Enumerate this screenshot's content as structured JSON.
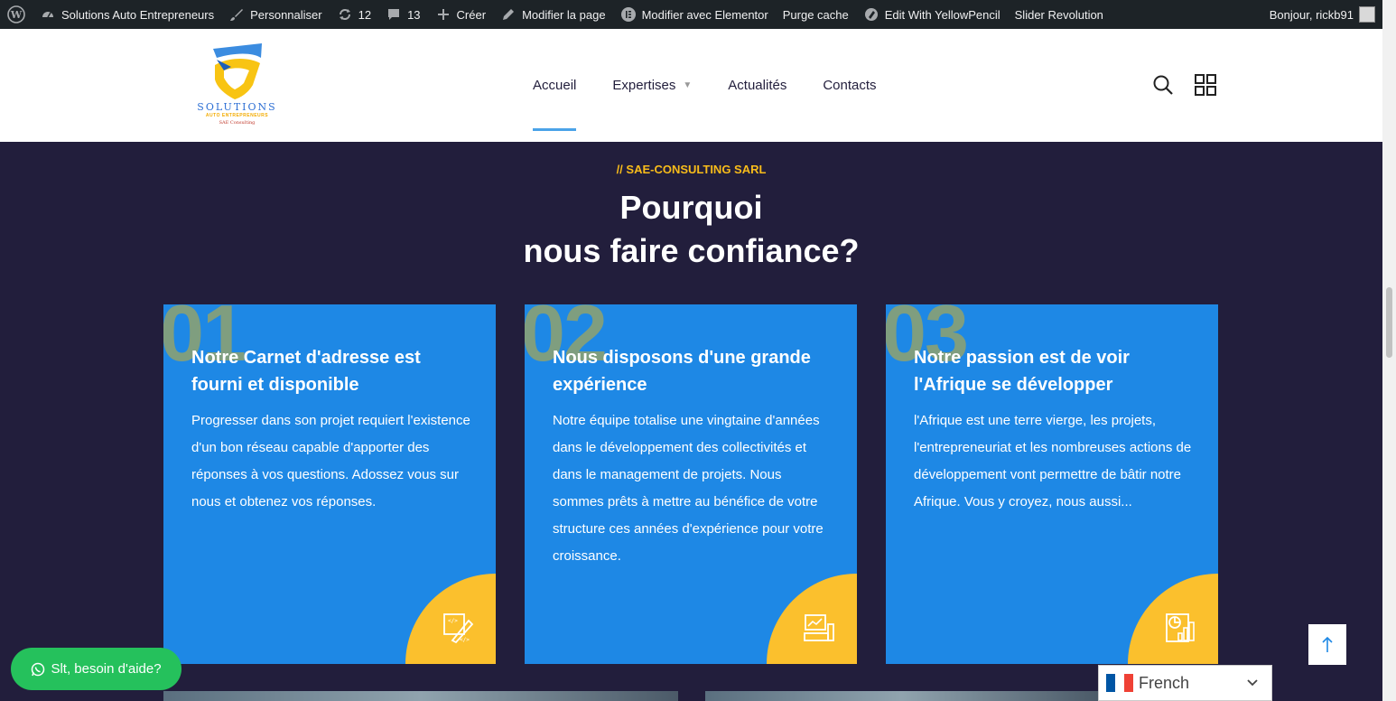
{
  "adminbar": {
    "site_name": "Solutions Auto Entrepreneurs",
    "customize": "Personnaliser",
    "updates_count": "12",
    "comments_count": "13",
    "new": "Créer",
    "edit_page": "Modifier la page",
    "elementor": "Modifier avec Elementor",
    "purge_cache": "Purge cache",
    "yellowpencil": "Edit With YellowPencil",
    "slider": "Slider Revolution",
    "greeting": "Bonjour, rickb91"
  },
  "logo": {
    "word": "SOLUTIONS",
    "sub": "AUTO ENTREPRENEURS",
    "sub2": "SAE Consulting"
  },
  "nav": {
    "items": [
      {
        "label": "Accueil"
      },
      {
        "label": "Expertises"
      },
      {
        "label": "Actualités"
      },
      {
        "label": "Contacts"
      }
    ]
  },
  "section": {
    "eyebrow": "// SAE-CONSULTING SARL",
    "title_line1": "Pourquoi",
    "title_line2": "nous faire confiance?"
  },
  "cards": [
    {
      "num": "01",
      "title": "Notre Carnet d'adresse est fourni et disponible",
      "text": "Progresser dans son projet requiert l'existence d'un bon réseau capable d'apporter des réponses à vos questions. Adossez vous sur nous et obtenez vos réponses."
    },
    {
      "num": "02",
      "title": "Nous disposons d'une grande expérience",
      "text": "Notre équipe totalise une vingtaine d'années dans le développement des collectivités et dans le management de projets. Nous sommes prêts à mettre au bénéfice de votre structure ces années d'expérience pour votre croissance."
    },
    {
      "num": "03",
      "title": "Notre passion est de voir l'Afrique se développer",
      "text": "l'Afrique est une terre vierge, les projets, l'entrepreneuriat et les nombreuses actions de développement vont permettre de bâtir notre Afrique. Vous y croyez, nous aussi..."
    }
  ],
  "whatsapp": {
    "label": "Slt, besoin d'aide?"
  },
  "language": {
    "selected": "French"
  },
  "colors": {
    "accent_yellow": "#fbc02d",
    "card_blue": "#1e88e5",
    "section_bg": "#221e3c",
    "whatsapp_green": "#25c15c"
  }
}
